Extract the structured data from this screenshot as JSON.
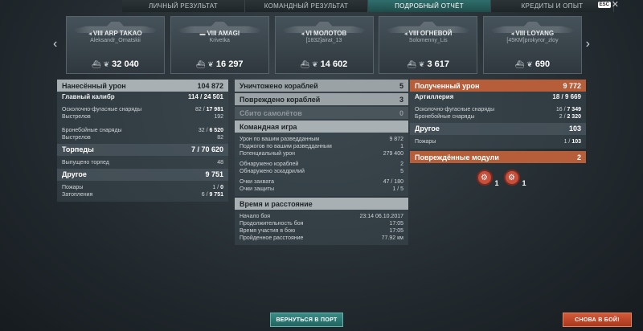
{
  "tabs": [
    {
      "label": "Личный результат",
      "active": false
    },
    {
      "label": "Командный результат",
      "active": false
    },
    {
      "label": "Подробный отчёт",
      "active": true
    },
    {
      "label": "Кредиты и опыт",
      "active": false
    }
  ],
  "esc_label": "ESC",
  "close_glyph": "✕",
  "nav": {
    "prev": "‹",
    "next": "›"
  },
  "cards": [
    {
      "tier": "VIII",
      "name": "ARP TAKAO",
      "player": "Aleksandr_Ornatskii",
      "kills_icon": "ship-icon",
      "value": "32 040"
    },
    {
      "tier": "VIII",
      "name": "AMAGI",
      "player": "Krivetka",
      "kills_icon": "ship-icon",
      "value": "16 297"
    },
    {
      "tier": "VI",
      "name": "МОЛОТОВ",
      "player": "[1832]airat_13",
      "kills_icon": "ship-icon",
      "value": "14 602"
    },
    {
      "tier": "VIII",
      "name": "ОГНЕВОЙ",
      "player": "Solomenny_Lis",
      "kills_icon": "ship-icon",
      "value": "3 617"
    },
    {
      "tier": "VIII",
      "name": "LOYANG",
      "player": "[45KM]prokyror_zloy",
      "kills_icon": "ship-icon",
      "value": "690"
    }
  ],
  "damage": {
    "title": "Нанесённый урон",
    "total": "104 872",
    "main_battery": {
      "label": "Главный калибр",
      "val": "114 / ",
      "bold": "24 501"
    },
    "he": {
      "label": "Осколочно-фугасные снаряды",
      "val": "82 / ",
      "bold": "17 981"
    },
    "he_shots": {
      "label": "Выстрелов",
      "val": "192"
    },
    "ap": {
      "label": "Бронебойные снаряды",
      "val": "32 / ",
      "bold": "6 520"
    },
    "ap_shots": {
      "label": "Выстрелов",
      "val": "82"
    },
    "torpedoes": {
      "label": "Торпеды",
      "val": "7 / ",
      "bold": "70 620"
    },
    "torp_fired": {
      "label": "Выпущено торпед",
      "val": "48"
    },
    "other": {
      "label": "Другое",
      "val": "9 751"
    },
    "fires": {
      "label": "Пожары",
      "val": "1 / ",
      "bold": "0"
    },
    "floods": {
      "label": "Затопления",
      "val": "6 / ",
      "bold": "9 751"
    }
  },
  "kills": {
    "destroyed": {
      "label": "Уничтожено кораблей",
      "val": "5"
    },
    "damaged": {
      "label": "Повреждено кораблей",
      "val": "3"
    },
    "planes": {
      "label": "Сбито самолётов",
      "val": "0"
    }
  },
  "team": {
    "title": "Командная игра",
    "rows": [
      {
        "label": "Урон по вашим разведданным",
        "val": "9 872"
      },
      {
        "label": "Поджогов по вашим разведданным",
        "val": "1"
      },
      {
        "label": "Потенциальный урон",
        "val": "279 400"
      },
      {
        "label": "Обнаружено кораблей",
        "val": "2"
      },
      {
        "label": "Обнаружено эскадрилий",
        "val": "5"
      },
      {
        "label": "Очки захвата",
        "val": "47 / 180"
      },
      {
        "label": "Очки защиты",
        "val": "1 / 5"
      }
    ]
  },
  "time": {
    "title": "Время и расстояние",
    "rows": [
      {
        "label": "Начало боя",
        "val": "23:14  06.10.2017"
      },
      {
        "label": "Продолжительность боя",
        "val": "17:05"
      },
      {
        "label": "Время участия в бою",
        "val": "17:05"
      },
      {
        "label": "Пройденное расстояние",
        "val": "77.92 км"
      }
    ]
  },
  "received": {
    "title": "Полученный урон",
    "total": "9 772",
    "artillery": {
      "label": "Артиллерия",
      "val": "18 / ",
      "bold": "9 669"
    },
    "he": {
      "label": "Осколочно-фугасные снаряды",
      "val": "16 / ",
      "bold": "7 349"
    },
    "ap": {
      "label": "Бронебойные снаряды",
      "val": "2 / ",
      "bold": "2 320"
    },
    "other": {
      "label": "Другое",
      "val": "103"
    },
    "fires": {
      "label": "Пожары",
      "val": "1 / ",
      "bold": "103"
    }
  },
  "modules": {
    "title": "Повреждённые модули",
    "val": "2",
    "items": [
      {
        "icon": "engine-icon",
        "count": "1"
      },
      {
        "icon": "steering-icon",
        "count": "1"
      }
    ]
  },
  "buttons": {
    "port": "Вернуться в порт",
    "battle": "Снова в бой!"
  }
}
